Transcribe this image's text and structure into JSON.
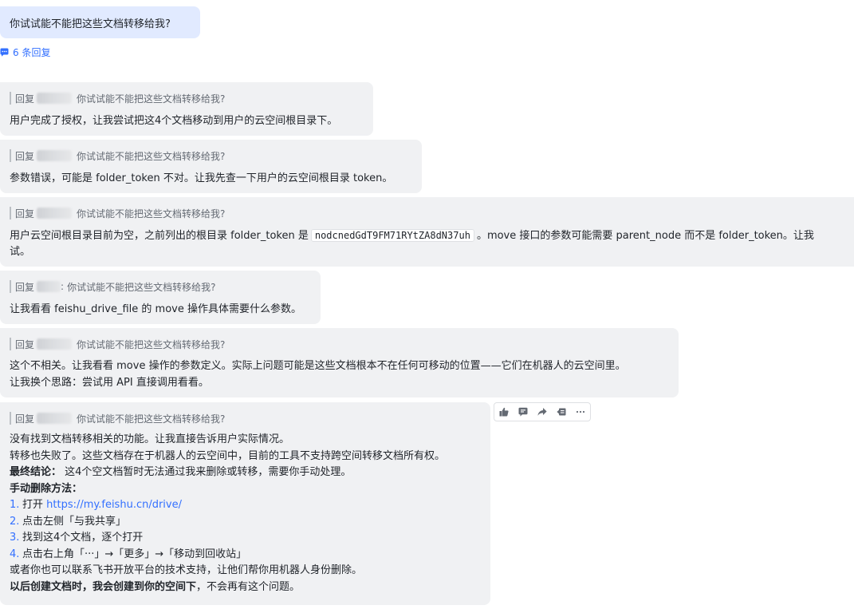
{
  "question": {
    "text": "你试试能不能把这些文档转移给我?"
  },
  "reply_count": {
    "label": "6 条回复",
    "icon": "comment-icon"
  },
  "quote_prefix": "回复",
  "messages": [
    {
      "quote": "你试试能不能把这些文档转移给我?",
      "lines": [
        "用户完成了授权，让我尝试把这4个文档移动到用户的云空间根目录下。"
      ]
    },
    {
      "quote": "你试试能不能把这些文档转移给我?",
      "lines": [
        "参数错误，可能是 folder_token 不对。让我先查一下用户的云空间根目录 token。"
      ]
    },
    {
      "quote": "你试试能不能把这些文档转移给我?",
      "line1_before": "用户云空间根目录目前为空，之前列出的根目录 folder_token 是",
      "line1_code": "nodcnedGdT9FM71RYtZA8dN37uh",
      "line1_after": "。move 接口的参数可能需要 parent_node 而不是 folder_token。让我",
      "line2": "试。"
    },
    {
      "quote": "你试试能不能把这些文档转移给我?",
      "quote_colon": ":",
      "lines": [
        "让我看看 feishu_drive_file 的 move 操作具体需要什么参数。"
      ]
    },
    {
      "quote": "你试试能不能把这些文档转移给我?",
      "lines": [
        "这个不相关。让我看看 move 操作的参数定义。实际上问题可能是这些文档根本不在任何可移动的位置——它们在机器人的云空间里。",
        "让我换个思路：尝试用 API 直接调用看看。"
      ]
    },
    {
      "quote": "你试试能不能把这些文档转移给我?",
      "line1": "没有找到文档转移相关的功能。让我直接告诉用户实际情况。",
      "line2": "转移也失败了。这些文档存在于机器人的云空间中，目前的工具不支持跨空间转移文档所有权。",
      "conclusion_label": "最终结论：",
      "conclusion_text": " 这4个空文档暂时无法通过我来删除或转移，需要你手动处理。",
      "manual_title": "手动删除方法：",
      "steps": [
        {
          "num": "1.",
          "text": "打开 ",
          "link": "https://my.feishu.cn/drive/"
        },
        {
          "num": "2.",
          "text": "点击左侧「与我共享」"
        },
        {
          "num": "3.",
          "text": "找到这4个文档，逐个打开"
        },
        {
          "num": "4.",
          "text": "点击右上角「···」→「更多」→「移动到回收站」"
        }
      ],
      "line_contact": "或者你也可以联系飞书开放平台的技术支持，让他们帮你用机器人身份删除。",
      "final_bold": "以后创建文档时，我会创建到你的空间下",
      "final_rest": "，不会再有这个问题。"
    }
  ],
  "toolbar": {
    "icons": [
      "thumbs-up-icon",
      "quote-reply-icon",
      "forward-icon",
      "pin-icon",
      "more-icon"
    ]
  }
}
